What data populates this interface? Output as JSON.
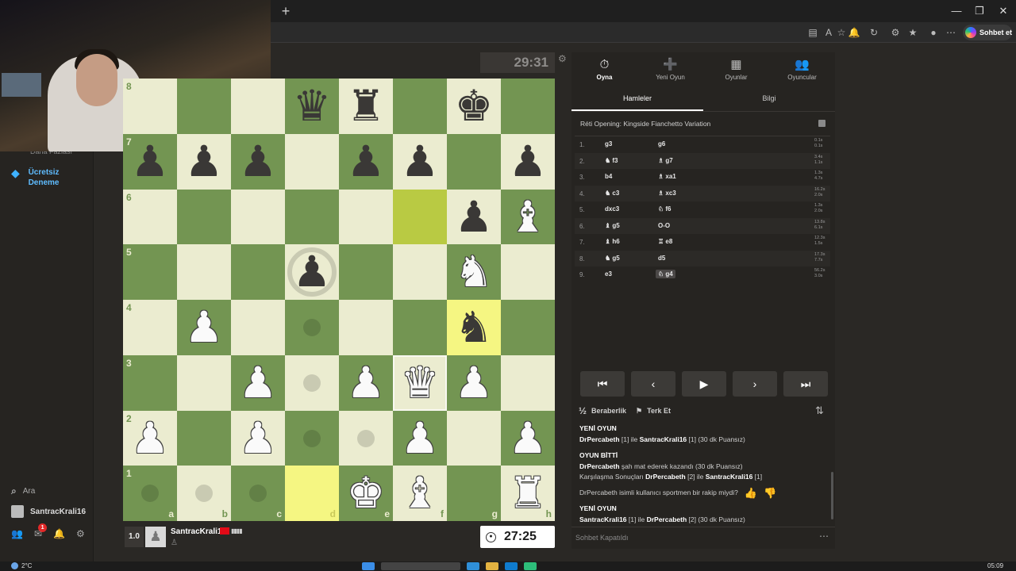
{
  "browser": {
    "new_tab": "+",
    "minimize": "—",
    "restore": "❐",
    "close": "✕",
    "copilot_label": "Sohbet et"
  },
  "sidebar": {
    "cut_text": "Daha Fazlası",
    "trial_label": "Ücretsiz Deneme",
    "search_label": "Ara",
    "username": "SantracKrali16",
    "mail_badge": "1"
  },
  "game": {
    "opponent_clock": "29:31",
    "my_clock": "27:25",
    "my_rating": "1.0",
    "my_name": "SantracKrali16",
    "board": [
      [
        "",
        "",
        "",
        "bq",
        "br",
        "",
        "bk",
        ""
      ],
      [
        "bp",
        "bp",
        "bp",
        "",
        "bp",
        "bp",
        "",
        "bp"
      ],
      [
        "",
        "",
        "",
        "",
        "",
        "",
        "bp",
        "wb"
      ],
      [
        "",
        "",
        "",
        "bp",
        "",
        "",
        "wn",
        ""
      ],
      [
        "",
        "wp",
        "",
        "",
        "",
        "",
        "bn",
        ""
      ],
      [
        "",
        "",
        "wp",
        "",
        "wp",
        "wq",
        "wp",
        ""
      ],
      [
        "wp",
        "",
        "wp",
        "",
        "",
        "wp",
        "",
        "wp"
      ],
      [
        "",
        "",
        "",
        "",
        "wk",
        "wb",
        "",
        "wr"
      ]
    ],
    "files": [
      "a",
      "b",
      "c",
      "d",
      "e",
      "f",
      "g",
      "h"
    ],
    "ranks": [
      "8",
      "7",
      "6",
      "5",
      "4",
      "3",
      "2",
      "1"
    ]
  },
  "panel": {
    "nav": [
      {
        "label": "Oyna",
        "icon": "⏱"
      },
      {
        "label": "Yeni Oyun",
        "icon": "➕"
      },
      {
        "label": "Oyunlar",
        "icon": "▦"
      },
      {
        "label": "Oyuncular",
        "icon": "👥"
      }
    ],
    "tabs": [
      "Hamleler",
      "Bilgi"
    ],
    "opening": "Réti Opening: Kingside Fianchetto Variation",
    "moves": [
      {
        "n": "1.",
        "w": "g3",
        "b": "g6",
        "tw": "0.1s",
        "tb": "0.1s"
      },
      {
        "n": "2.",
        "w": "♞ f3",
        "b": "♗ g7",
        "tw": "3.4s",
        "tb": "1.1s"
      },
      {
        "n": "3.",
        "w": "b4",
        "b": "♗ xa1",
        "tw": "1.3s",
        "tb": "4.7s"
      },
      {
        "n": "4.",
        "w": "♞ c3",
        "b": "♗ xc3",
        "tw": "16.2s",
        "tb": "2.0s"
      },
      {
        "n": "5.",
        "w": "dxc3",
        "b": "♘ f6",
        "tw": "1.3s",
        "tb": "2.0s"
      },
      {
        "n": "6.",
        "w": "♝ g5",
        "b": "O-O",
        "tw": "13.8s",
        "tb": "6.1s"
      },
      {
        "n": "7.",
        "w": "♝ h6",
        "b": "♖ e8",
        "tw": "12.3s",
        "tb": "1.5s"
      },
      {
        "n": "8.",
        "w": "♞ g5",
        "b": "d5",
        "tw": "17.3s",
        "tb": "7.7s"
      },
      {
        "n": "9.",
        "w": "e3",
        "b": "♘ g4",
        "tw": "56.2s",
        "tb": "3.0s"
      }
    ],
    "draw_label": "Beraberlik",
    "resign_label": "Terk Et",
    "chat": {
      "h1": "YENİ OYUN",
      "l1a": "DrPercabeth",
      "l1b": " [1] ile ",
      "l1c": "SantracKrali16",
      "l1d": " [1] (30 dk Puansız)",
      "h2": "OYUN BİTTİ",
      "l2a": "DrPercabeth",
      "l2b": " şah mat ederek kazandı (30 dk Puansız)",
      "l3a": "Karşılaşma Sonuçları ",
      "l3b": "DrPercabeth",
      "l3c": " [2] ile ",
      "l3d": "SantracKrali16",
      "l3e": " [1]",
      "q": "DrPercabeth isimli kullanıcı sportmen bir rakip miydi?",
      "h3": "YENİ OYUN",
      "l4a": "SantracKrali16",
      "l4b": " [1] ile ",
      "l4c": "DrPercabeth",
      "l4d": " [2] (30 dk Puansız)"
    },
    "chat_placeholder": "Sohbet Kapatıldı"
  },
  "taskbar": {
    "temp": "2°C",
    "time": "05:09"
  },
  "colors": {
    "light_square": "#ebecd0",
    "dark_square": "#739552",
    "highlight": "#f5f682",
    "accent_blue": "#5fbcff"
  }
}
